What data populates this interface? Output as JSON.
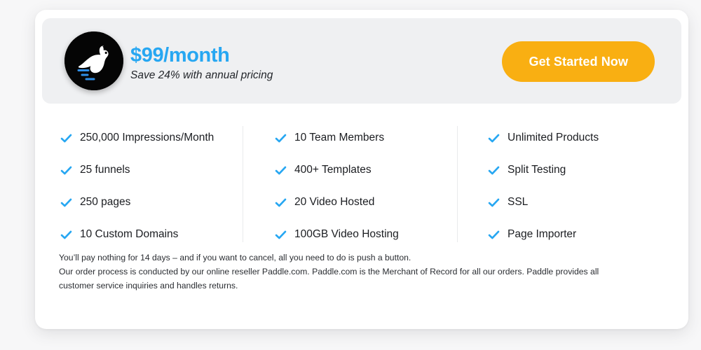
{
  "colors": {
    "page_background": "#f7f7f8",
    "card_background": "#ffffff",
    "header_band": "#eff0f2",
    "accent_blue": "#27a7f2",
    "cta_orange": "#f9af12",
    "logo_black": "#050505",
    "divider": "#e9eaec",
    "text_dark": "#1b1d21"
  },
  "header": {
    "logo_icon": "rabbit-logo-icon",
    "price": "$99/month",
    "savings_note": "Save 24% with annual pricing",
    "cta_label": "Get Started Now"
  },
  "features": {
    "check_icon": "check-icon",
    "columns": [
      {
        "items": [
          "250,000 Impressions/Month",
          "25 funnels",
          "250 pages",
          "10 Custom Domains"
        ]
      },
      {
        "items": [
          "10 Team Members",
          "400+ Templates",
          "20 Video Hosted",
          "100GB Video Hosting"
        ]
      },
      {
        "items": [
          "Unlimited Products",
          "Split Testing",
          "SSL",
          "Page Importer"
        ]
      }
    ]
  },
  "fine_print": {
    "line1": "You’ll pay nothing for 14 days – and if you want to cancel, all you need to do is push a button.",
    "line2": "Our order process is conducted by our online reseller Paddle.com.  Paddle.com is the Merchant of Record for all our orders.  Paddle provides all",
    "line3": "customer service inquiries and handles returns."
  }
}
